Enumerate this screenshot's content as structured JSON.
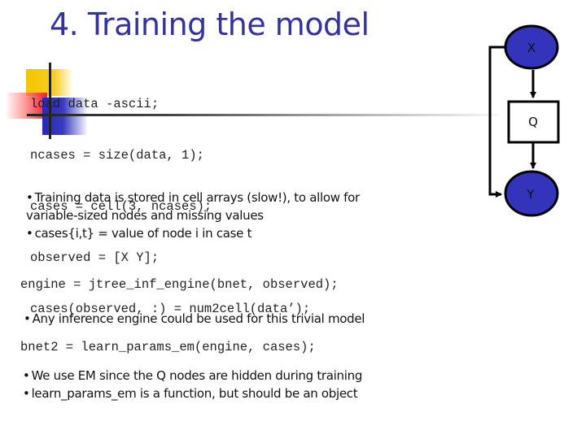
{
  "slide": {
    "title": "4. Training the model",
    "code_block_1": [
      "load data -ascii;",
      "ncases = size(data, 1);",
      "cases = cell(3, ncases);",
      "observed = [X Y];",
      "cases(observed, :) = num2cell(data’);"
    ],
    "bullets_1": [
      "Training data is stored in cell arrays (slow!), to allow for",
      "variable-sized nodes and missing values",
      "cases{i,t} = value of node i in case t"
    ],
    "code_engine": "engine = jtree_inf_engine(bnet, observed);",
    "bullets_2": [
      "Any inference engine could be used for this trivial model"
    ],
    "code_bnet2": "bnet2 = learn_params_em(engine, cases);",
    "bullets_3": [
      "We use EM since the Q nodes are hidden during training",
      "learn_params_em is a function, but should be an object"
    ],
    "bullet_char": "•"
  },
  "diagram": {
    "nodes": [
      {
        "id": "X",
        "label": "X",
        "shape": "ellipse",
        "fill": "#3333bb"
      },
      {
        "id": "Q",
        "label": "Q",
        "shape": "rectangle",
        "fill": "#ffffff"
      },
      {
        "id": "Y",
        "label": "Y",
        "shape": "ellipse",
        "fill": "#3333bb"
      }
    ],
    "edges": [
      {
        "from": "X",
        "to": "Q"
      },
      {
        "from": "Q",
        "to": "Y"
      },
      {
        "from": "X",
        "to": "Y"
      }
    ]
  },
  "colors": {
    "title": "#333399",
    "node_fill": "#3333bb",
    "deco_yellow": "#f5c400",
    "deco_red": "#f5202a",
    "deco_blue": "#2929b5"
  }
}
